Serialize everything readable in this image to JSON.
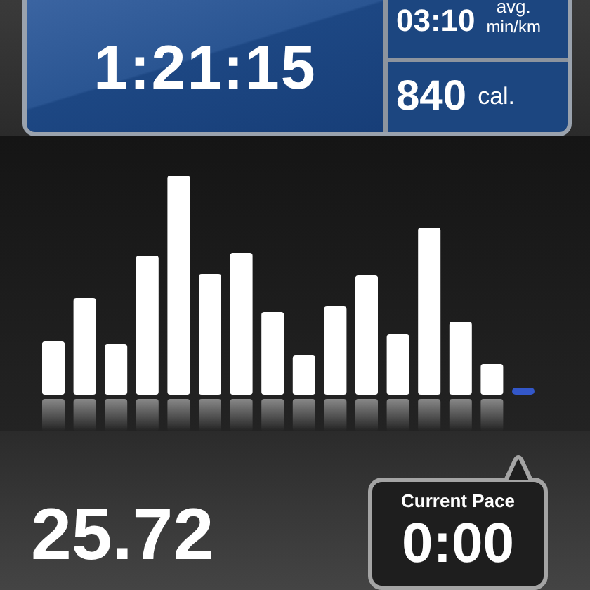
{
  "stats_panel": {
    "duration": "1:21:15",
    "pace": {
      "value": "03:10",
      "label_top": "avg.",
      "label_bottom": "min/km"
    },
    "calories": {
      "value": "840",
      "unit": "cal."
    }
  },
  "distance": "25.72",
  "current_pace": {
    "label": "Current Pace",
    "value": "0:00"
  }
}
